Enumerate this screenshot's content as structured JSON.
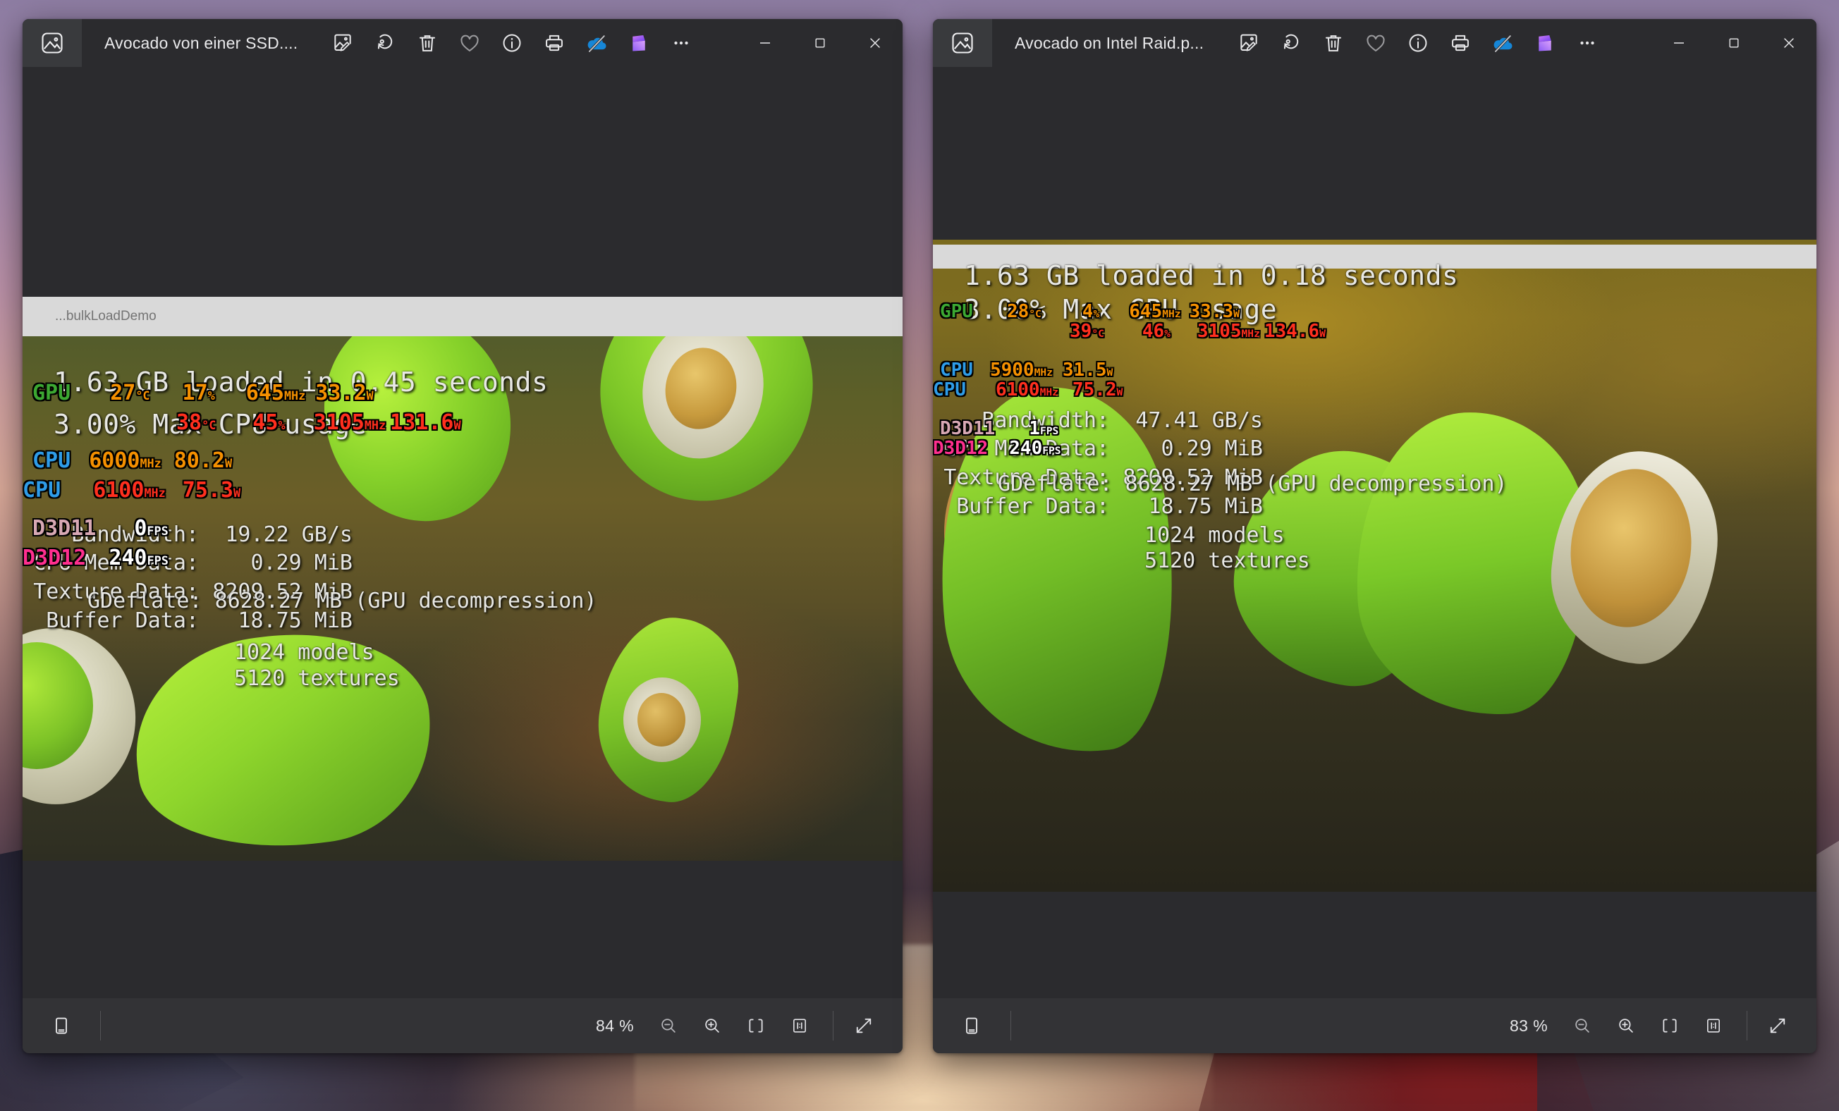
{
  "desktop": {
    "wallpaper_colors": [
      "#8e7da3",
      "#cfa09f",
      "#d9a999",
      "#6d4e58",
      "#443540"
    ]
  },
  "windows": [
    {
      "id": "left",
      "title": "Avocado von einer SSD....",
      "app_icon": "photos-app-icon",
      "toolbar": [
        {
          "name": "edit-image-icon",
          "label": "Edit image"
        },
        {
          "name": "rotate-icon",
          "label": "Rotate"
        },
        {
          "name": "delete-icon",
          "label": "Delete"
        },
        {
          "name": "favorite-icon",
          "label": "Add to favorites"
        },
        {
          "name": "info-icon",
          "label": "File info"
        },
        {
          "name": "print-icon",
          "label": "Print"
        },
        {
          "name": "onedrive-off-icon",
          "label": "OneDrive not syncing"
        },
        {
          "name": "clipchamp-icon",
          "label": "Create video"
        },
        {
          "name": "more-icon",
          "label": "See more"
        }
      ],
      "caption": {
        "minimize": "minimize-button",
        "maximize": "maximize-button",
        "close": "close-button"
      },
      "captured_window_label": "...bulkLoadDemo",
      "osd_orange": {
        "rows": [
          {
            "key": "GPU",
            "key_class": "k-gpu",
            "fields": [
              {
                "value": "27",
                "unit": "°C"
              },
              {
                "value": "17",
                "unit": "%"
              },
              {
                "value": "645",
                "unit": "MHz"
              },
              {
                "value": "33.2",
                "unit": "W"
              }
            ]
          },
          {
            "key": "CPU",
            "key_class": "k-cpu",
            "fields": [
              {
                "value": "6000",
                "unit": "MHz"
              },
              {
                "value": "80.2",
                "unit": "W"
              }
            ]
          },
          {
            "key": "D3D11",
            "key_class": "k-d3d11",
            "fps": "0",
            "fps_unit": "FPS"
          }
        ]
      },
      "osd_red": {
        "rows": [
          {
            "key": "",
            "fields": [
              {
                "value": "38",
                "unit": "°C"
              },
              {
                "value": "45",
                "unit": "%"
              },
              {
                "value": "3105",
                "unit": "MHz"
              },
              {
                "value": "131.6",
                "unit": "W"
              }
            ]
          },
          {
            "key": "CPU",
            "key_class": "k-cpu",
            "fields": [
              {
                "value": "6100",
                "unit": "MHz"
              },
              {
                "value": "75.3",
                "unit": "W"
              }
            ]
          },
          {
            "key": "D3D12",
            "key_class": "k-d3d12",
            "fps": "240",
            "fps_unit": "FPS"
          }
        ]
      },
      "benchmark": {
        "headline": "1.63 GB loaded in 0.45 seconds",
        "cpu_line": "3.00% Max CPU usage",
        "stats": [
          {
            "label": "Bandwidth:",
            "value": "19.22 GB/s"
          },
          {
            "label": "CPU Mem Data:",
            "value": "0.29 MiB"
          },
          {
            "label": "Texture Data:",
            "value": "8209.52 MiB"
          },
          {
            "label": "Buffer Data:",
            "value": "18.75 MiB"
          }
        ],
        "gdeflate": "GDeflate: 8628.27 MB (GPU decompression)",
        "models": "1024 models",
        "textures": "5120 textures"
      },
      "bottombar": {
        "filmstrip_icon": "filmstrip-icon",
        "zoom_percent": "84 %",
        "buttons": [
          {
            "name": "zoom-out-button",
            "label": "Zoom out"
          },
          {
            "name": "zoom-in-button",
            "label": "Zoom in"
          },
          {
            "name": "fit-to-window-button",
            "label": "Fit to window"
          },
          {
            "name": "actual-size-button",
            "label": "Actual size 1:1"
          },
          {
            "name": "fullscreen-button",
            "label": "Full screen"
          }
        ]
      }
    },
    {
      "id": "right",
      "title": "Avocado on Intel Raid.p...",
      "app_icon": "photos-app-icon",
      "toolbar": [
        {
          "name": "edit-image-icon",
          "label": "Edit image"
        },
        {
          "name": "rotate-icon",
          "label": "Rotate"
        },
        {
          "name": "delete-icon",
          "label": "Delete"
        },
        {
          "name": "favorite-icon",
          "label": "Add to favorites"
        },
        {
          "name": "info-icon",
          "label": "File info"
        },
        {
          "name": "print-icon",
          "label": "Print"
        },
        {
          "name": "onedrive-off-icon",
          "label": "OneDrive not syncing"
        },
        {
          "name": "clipchamp-icon",
          "label": "Create video"
        },
        {
          "name": "more-icon",
          "label": "See more"
        }
      ],
      "caption": {
        "minimize": "minimize-button",
        "maximize": "maximize-button",
        "close": "close-button"
      },
      "captured_window_label": "",
      "osd_orange": {
        "rows": [
          {
            "key": "GPU",
            "key_class": "k-gpu",
            "fields": [
              {
                "value": "28",
                "unit": "°C"
              },
              {
                "value": "4",
                "unit": "%"
              },
              {
                "value": "645",
                "unit": "MHz"
              },
              {
                "value": "33.3",
                "unit": "W"
              }
            ]
          },
          {
            "key": "CPU",
            "key_class": "k-cpu",
            "fields": [
              {
                "value": "5900",
                "unit": "MHz"
              },
              {
                "value": "31.5",
                "unit": "W"
              }
            ]
          },
          {
            "key": "D3D11",
            "key_class": "k-d3d11",
            "fps": "1",
            "fps_unit": "FPS"
          }
        ]
      },
      "osd_red": {
        "rows": [
          {
            "key": "",
            "fields": [
              {
                "value": "39",
                "unit": "°C"
              },
              {
                "value": "46",
                "unit": "%"
              },
              {
                "value": "3105",
                "unit": "MHz"
              },
              {
                "value": "134.6",
                "unit": "W"
              }
            ]
          },
          {
            "key": "CPU",
            "key_class": "k-cpu",
            "fields": [
              {
                "value": "6100",
                "unit": "MHz"
              },
              {
                "value": "75.2",
                "unit": "W"
              }
            ]
          },
          {
            "key": "D3D12",
            "key_class": "k-d3d12",
            "fps": "240",
            "fps_unit": "FPS"
          }
        ]
      },
      "benchmark": {
        "headline": "1.63 GB loaded in 0.18 seconds",
        "cpu_line": "3.00% Max CPU usage",
        "stats": [
          {
            "label": "Bandwidth:",
            "value": "47.41 GB/s"
          },
          {
            "label": "CPU Mem Data:",
            "value": "0.29 MiB"
          },
          {
            "label": "Texture Data:",
            "value": "8209.52 MiB"
          },
          {
            "label": "Buffer Data:",
            "value": "18.75 MiB"
          }
        ],
        "gdeflate": "GDeflate: 8628.27 MB (GPU decompression)",
        "models": "1024 models",
        "textures": "5120 textures"
      },
      "bottombar": {
        "filmstrip_icon": "filmstrip-icon",
        "zoom_percent": "83 %",
        "buttons": [
          {
            "name": "zoom-out-button",
            "label": "Zoom out"
          },
          {
            "name": "zoom-in-button",
            "label": "Zoom in"
          },
          {
            "name": "fit-to-window-button",
            "label": "Fit to window"
          },
          {
            "name": "actual-size-button",
            "label": "Actual size 1:1"
          },
          {
            "name": "fullscreen-button",
            "label": "Full screen"
          }
        ]
      }
    }
  ]
}
